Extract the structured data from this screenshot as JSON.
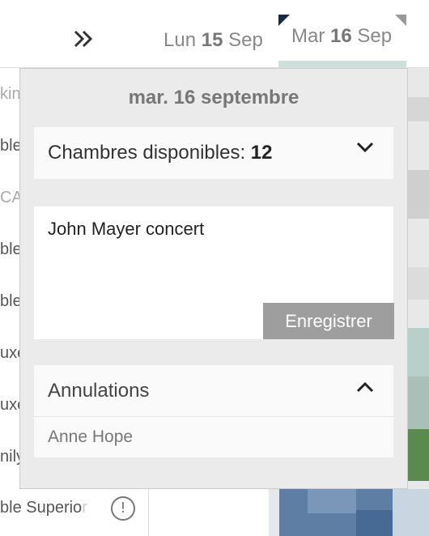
{
  "header": {
    "expand_icon": "double-chevron-right-icon",
    "days": [
      {
        "weekday": "Lun",
        "day": "15",
        "month": "Sep"
      },
      {
        "weekday": "Mar",
        "day": "16",
        "month": "Sep"
      }
    ]
  },
  "rooms_list": {
    "labels": [
      "kin",
      "ble",
      "CA",
      "ble",
      "ble",
      "uxe",
      "uxe",
      "nily"
    ],
    "last_row": {
      "label_visible": "ble Superio",
      "label_faded": "r",
      "icon": "exclamation-circle-icon"
    }
  },
  "popover": {
    "date_title": "mar. 16 septembre",
    "availability": {
      "label": "Chambres disponibles:",
      "value": "12",
      "icon": "chevron-down-icon"
    },
    "note": {
      "text": "John Mayer concert",
      "save_label": "Enregistrer"
    },
    "cancellations": {
      "title": "Annulations",
      "icon": "chevron-up-icon",
      "items": [
        "Anne Hope"
      ]
    }
  },
  "colors": {
    "popover_bg": "#ebebeb",
    "save_button": "#9e9e9e",
    "selected_day_underline": "#cfe0dc",
    "corner_marker": "#1a2a44"
  }
}
